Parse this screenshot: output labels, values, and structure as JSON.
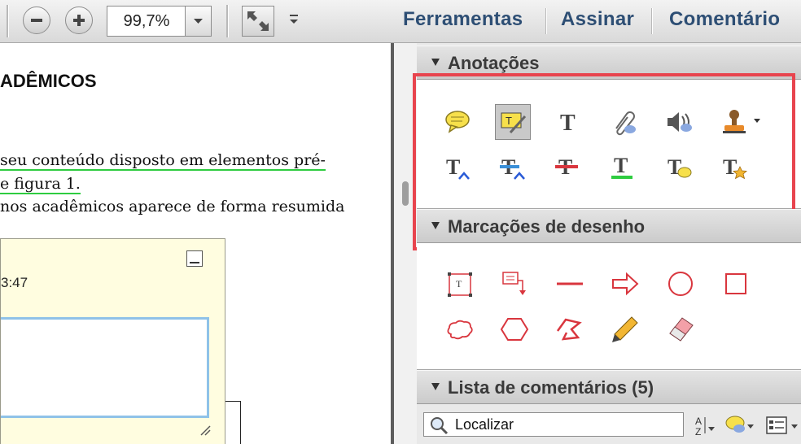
{
  "toolbar": {
    "zoom_value": "99,7%",
    "links": {
      "tools": "Ferramentas",
      "sign": "Assinar",
      "comment": "Comentário"
    },
    "link_color": "#2d4e74"
  },
  "document": {
    "heading": "ADÊMICOS",
    "lines": [
      "seu conteúdo disposto em elementos pré-",
      "e figura 1.",
      "nos acadêmicos aparece de forma resumida"
    ],
    "note": {
      "time": "3:47"
    }
  },
  "panel": {
    "annotations": {
      "title": "Anotações",
      "tools": [
        "sticky-note-icon",
        "highlight-text-icon",
        "add-text-icon",
        "attach-file-icon",
        "record-audio-icon",
        "stamp-icon",
        "insert-text-icon",
        "replace-text-icon",
        "strikethrough-icon",
        "underline-icon",
        "text-comment-icon",
        "text-star-icon"
      ]
    },
    "drawing": {
      "title": "Marcações de desenho",
      "tools": [
        "text-box-icon",
        "callout-icon",
        "line-icon",
        "arrow-icon",
        "oval-icon",
        "rectangle-icon",
        "cloud-icon",
        "polygon-icon",
        "connected-lines-icon",
        "pencil-icon",
        "eraser-icon"
      ]
    },
    "comments_list": {
      "title": "Lista de comentários (5)",
      "search_value": "Localizar"
    }
  },
  "colors": {
    "highlight_border": "#e8444e",
    "note_bg": "#fffde0",
    "drawing_red": "#d9363e"
  }
}
